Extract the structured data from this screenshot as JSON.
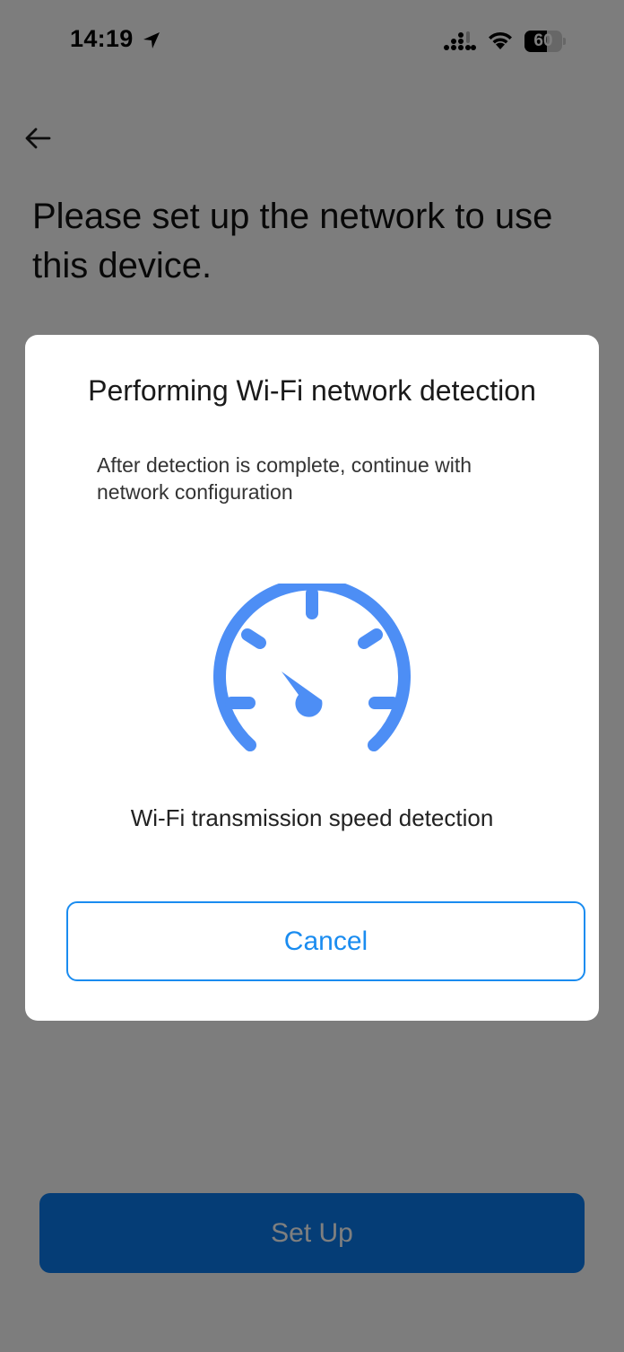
{
  "status_bar": {
    "time": "14:19",
    "location_icon": "location-arrow-icon",
    "signal_icon": "cellular-signal-icon",
    "wifi_icon": "wifi-icon",
    "battery_percent": 60,
    "battery_label": "60"
  },
  "header": {
    "back_icon": "arrow-left-icon",
    "title": "Please set up the network to use this device."
  },
  "dialog": {
    "title": "Performing Wi-Fi network detection",
    "description": "After detection is complete, continue with network configuration",
    "icon": "speedometer-icon",
    "caption": "Wi-Fi transmission speed detection",
    "cancel_label": "Cancel"
  },
  "footer": {
    "setup_label": "Set Up"
  },
  "colors": {
    "accent": "#1a8cf0",
    "gauge": "#4d8ef5",
    "primary_button": "#0a7bec",
    "overlay": "rgba(0,0,0,0.5)"
  }
}
